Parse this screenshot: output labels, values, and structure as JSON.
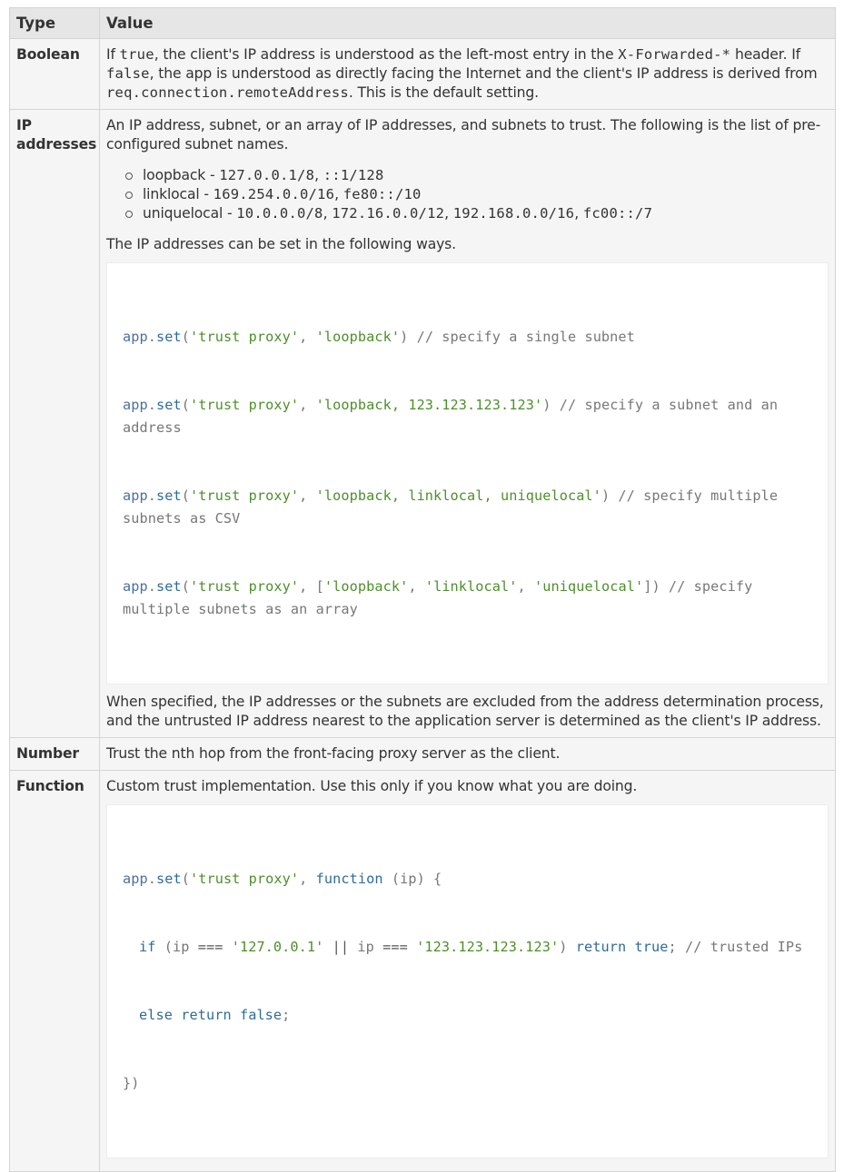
{
  "header": {
    "type": "Type",
    "value": "Value"
  },
  "rows": {
    "boolean": {
      "type": "Boolean",
      "t1": "If ",
      "code_true": "true",
      "t2": ", the client's IP address is understood as the left-most entry in the ",
      "code_header": "X-Forwarded-*",
      "t3": " header. If ",
      "code_false": "false",
      "t4": ", the app is understood as directly facing the Internet and the client's IP address is derived from ",
      "code_remote": "req.connection.remoteAddress",
      "t5": ". This is the default setting."
    },
    "ip": {
      "type": "IP addresses",
      "intro": "An IP address, subnet, or an array of IP addresses, and subnets to trust. The following is the list of pre-configured subnet names.",
      "subnets": [
        {
          "name": "loopback",
          "sep": " - ",
          "addresses": [
            "127.0.0.1/8",
            "::1/128"
          ]
        },
        {
          "name": "linklocal",
          "sep": " - ",
          "addresses": [
            "169.254.0.0/16",
            "fe80::/10"
          ]
        },
        {
          "name": "uniquelocal",
          "sep": " - ",
          "addresses": [
            "10.0.0.0/8",
            "172.16.0.0/12",
            "192.168.0.0/16",
            "fc00::/7"
          ]
        }
      ],
      "ways": "The IP addresses can be set in the following ways.",
      "code": {
        "obj": "app",
        "dot": ".",
        "method": "set",
        "lines": [
          {
            "args_open": "(",
            "arg1": "'trust proxy'",
            "comma": ", ",
            "arg2": "'loopback'",
            "close": ")",
            "comment": " // specify a single subnet"
          },
          {
            "args_open": "(",
            "arg1": "'trust proxy'",
            "comma": ", ",
            "arg2": "'loopback, 123.123.123.123'",
            "close": ")",
            "comment": " // specify a subnet and an address"
          },
          {
            "args_open": "(",
            "arg1": "'trust proxy'",
            "comma": ", ",
            "arg2": "'loopback, linklocal, uniquelocal'",
            "close": ")",
            "comment": " // specify multiple subnets as CSV"
          }
        ],
        "array_line": {
          "args_open": "(",
          "arg1": "'trust proxy'",
          "comma": ", ",
          "bracket_open": "[",
          "items": [
            "'loopback'",
            "'linklocal'",
            "'uniquelocal'"
          ],
          "item_sep": ", ",
          "bracket_close": "]",
          "close": ")",
          "comment": " // specify multiple subnets as an array"
        }
      },
      "outro": "When specified, the IP addresses or the subnets are excluded from the address determination process, and the untrusted IP address nearest to the application server is determined as the client's IP address."
    },
    "number": {
      "type": "Number",
      "value": "Trust the nth hop from the front-facing proxy server as the client."
    },
    "function": {
      "type": "Function",
      "value": "Custom trust implementation. Use this only if you know what you are doing.",
      "code": {
        "l1_obj": "app",
        "l1_dot": ".",
        "l1_method": "set",
        "l1_open": "(",
        "l1_str": "'trust proxy'",
        "l1_comma": ", ",
        "l1_kw": "function",
        "l1_params": " (ip) {",
        "l2_if": "if",
        "l2_open": " (",
        "l2_ip1": "ip",
        "l2_eq1": " === ",
        "l2_s1": "'127.0.0.1'",
        "l2_or": " || ",
        "l2_ip2": "ip",
        "l2_eq2": " === ",
        "l2_s2": "'123.123.123.123'",
        "l2_close": ") ",
        "l2_ret": "return",
        "l2_sp": " ",
        "l2_true": "true",
        "l2_semi": "; ",
        "l2_comment": "// trusted IPs",
        "l3_else": "else",
        "l3_sp1": " ",
        "l3_ret": "return",
        "l3_sp2": " ",
        "l3_false": "false",
        "l3_semi": ";",
        "l4": "})"
      }
    }
  }
}
